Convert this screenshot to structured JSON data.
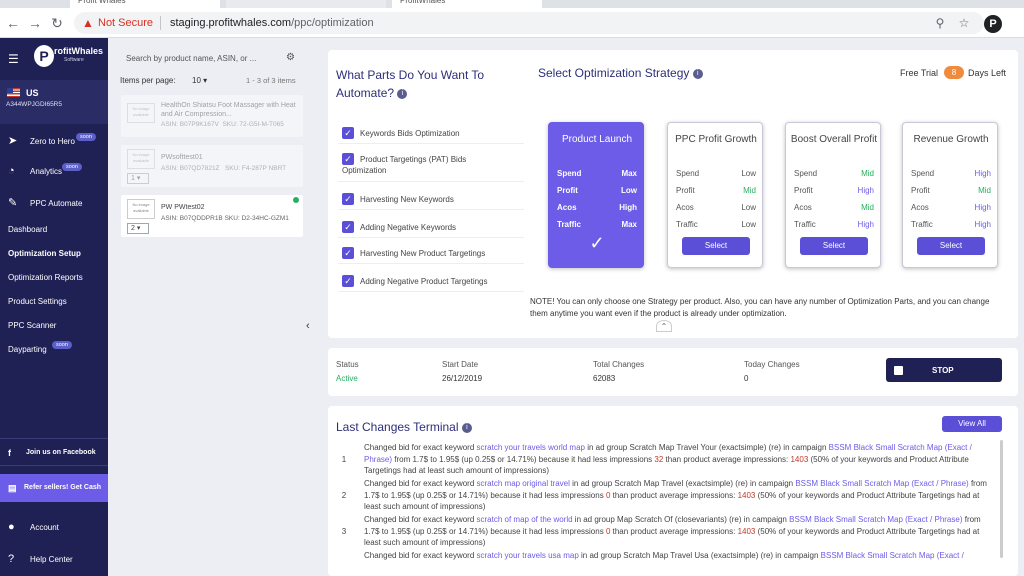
{
  "browser": {
    "tabs": [
      "Profit Whales",
      "",
      "ProfitWhales"
    ],
    "security_label": "Not Secure",
    "url_host": "staging.profitwhales.com",
    "url_path": "/ppc/optimization",
    "profile_initial": "P"
  },
  "sidebar": {
    "logo_text": "rofitWhales",
    "logo_mark": "P",
    "logo_sub": "Software",
    "account_country": "US",
    "account_id": "A344WPJGDI65R5",
    "items": [
      {
        "label": "Zero to Hero",
        "badge": "soon"
      },
      {
        "label": "Analytics",
        "badge": "soon"
      },
      {
        "label": "PPC Automate",
        "badge": ""
      },
      {
        "label": "Dashboard",
        "badge": ""
      },
      {
        "label": "Optimization Setup",
        "badge": ""
      },
      {
        "label": "Optimization Reports",
        "badge": ""
      },
      {
        "label": "Product Settings",
        "badge": ""
      },
      {
        "label": "PPC Scanner",
        "badge": ""
      },
      {
        "label": "Dayparting",
        "badge": "soon"
      }
    ],
    "facebook_label": "Join us on Facebook",
    "refer_label": "Refer sellers! Get Cash",
    "account_label": "Account",
    "help_label": "Help Center"
  },
  "products": {
    "search_placeholder": "Search by product name, ASIN, or ...",
    "items_per_page_label": "Items per page:",
    "items_per_page": "10",
    "count": "1 - 3 of 3 items",
    "list": [
      {
        "image_text": "No image available",
        "name": "HealthOn Shiatsu Foot Massager with Heat and Air Compression...",
        "asin": "ASIN: B07P9K167V",
        "sku": "SKU: 72-G5I-M-T065",
        "qty": ""
      },
      {
        "image_text": "No image available",
        "name": "PWsofttest01",
        "asin": "ASIN: B07QD7821Z",
        "sku": "SKU: F4-287P NBRT",
        "qty": "1"
      },
      {
        "image_text": "No image available",
        "name": "PW PWtest02",
        "asin": "ASIN: B07QDDPR1B",
        "sku": "SKU: D2-34HC-GZM1",
        "qty": "2"
      }
    ]
  },
  "parts": {
    "title": "What Parts Do You Want To Automate?",
    "items": [
      "Keywords Bids Optimization",
      "Product Targetings (PAT) Bids Optimization",
      "Harvesting New Keywords",
      "Adding Negative Keywords",
      "Harvesting New Product Targetings",
      "Adding Negative Product Targetings"
    ]
  },
  "strategy": {
    "title": "Select Optimization Strategy",
    "trial_label": "Free Trial",
    "trial_days": "8",
    "trial_suffix": "Days Left",
    "select_label": "Select",
    "cards": [
      {
        "title": "Product Launch",
        "rows": [
          [
            "Spend",
            "Max"
          ],
          [
            "Profit",
            "Low"
          ],
          [
            "Acos",
            "High"
          ],
          [
            "Traffic",
            "Max"
          ]
        ]
      },
      {
        "title": "PPC Profit Growth",
        "rows": [
          [
            "Spend",
            "Low"
          ],
          [
            "Profit",
            "Mid"
          ],
          [
            "Acos",
            "Low"
          ],
          [
            "Traffic",
            "Low"
          ]
        ]
      },
      {
        "title": "Boost Overall Profit",
        "rows": [
          [
            "Spend",
            "Mid"
          ],
          [
            "Profit",
            "High"
          ],
          [
            "Acos",
            "Mid"
          ],
          [
            "Traffic",
            "High"
          ]
        ]
      },
      {
        "title": "Revenue Growth",
        "rows": [
          [
            "Spend",
            "High"
          ],
          [
            "Profit",
            "Mid"
          ],
          [
            "Acos",
            "High"
          ],
          [
            "Traffic",
            "High"
          ]
        ]
      }
    ],
    "note": "NOTE! You can only choose one Strategy per product. Also, you can have any number of Optimization Parts, and you can change them anytime you want even if the product is already under optimization."
  },
  "status": {
    "status_label": "Status",
    "status_value": "Active",
    "start_label": "Start Date",
    "start_value": "26/12/2019",
    "total_label": "Total Changes",
    "total_value": "62083",
    "today_label": "Today Changes",
    "today_value": "0",
    "stop_label": "STOP"
  },
  "terminal": {
    "title": "Last Changes Terminal",
    "view_all": "View All",
    "entries": [
      {
        "num": "1",
        "p1": "Changed bid for exact keyword ",
        "kw": "scratch your travels world map",
        "p2": " in ad group Scratch Map Travel Your (exactsimple) (re) in campaign ",
        "camp": "BSSM Black Small Scratch Map (Exact / Phrase)",
        "p3": " from 1.7$ to 1.95$ (up 0.25$ or 14.71%) because it had less impressions ",
        "n1": "32",
        "p4": " than product average impressions: ",
        "n2": "1403",
        "p5": " (50% of your keywords and Product Attribute Targetings had at least such amount of impressions)"
      },
      {
        "num": "2",
        "p1": "Changed bid for exact keyword ",
        "kw": "scratch map original travel",
        "p2": " in ad group Scratch Map Travel (exactsimple) (re) in campaign ",
        "camp": "BSSM Black Small Scratch Map (Exact / Phrase)",
        "p3": " from 1.7$ to 1.95$ (up 0.25$ or 14.71%) because it had less impressions ",
        "n1": "0",
        "p4": " than product average impressions: ",
        "n2": "1403",
        "p5": " (50% of your keywords and Product Attribute Targetings had at least such amount of impressions)"
      },
      {
        "num": "3",
        "p1": "Changed bid for exact keyword ",
        "kw": "scratch of map of the world",
        "p2": " in ad group Map Scratch Of (closevariants) (re) in campaign ",
        "camp": "BSSM Black Small Scratch Map (Exact / Phrase)",
        "p3": " from 1.7$ to 1.95$ (up 0.25$ or 14.71%) because it had less impressions ",
        "n1": "0",
        "p4": " than product average impressions: ",
        "n2": "1403",
        "p5": " (50% of your keywords and Product Attribute Targetings had at least such amount of impressions)"
      },
      {
        "num": "",
        "p1": "Changed bid for exact keyword ",
        "kw": "scratch your travels usa map",
        "p2": " in ad group Scratch Map Travel Usa (exactsimple) (re) in campaign ",
        "camp": "BSSM Black Small Scratch Map (Exact /",
        "p3": "",
        "n1": "",
        "p4": "",
        "n2": "",
        "p5": ""
      }
    ]
  }
}
